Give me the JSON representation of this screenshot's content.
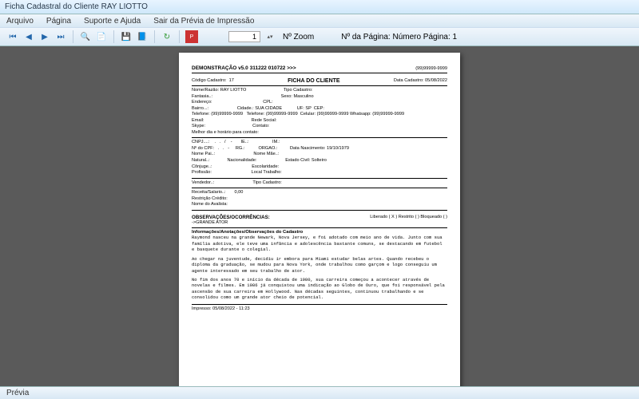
{
  "window": {
    "title": "Ficha Cadastral do Cliente RAY LIOTTO"
  },
  "menu": {
    "arquivo": "Arquivo",
    "pagina": "Página",
    "suporte": "Suporte e Ajuda",
    "sair": "Sair da Prévia de Impressão"
  },
  "toolbar": {
    "zoom_value": "1",
    "zoom_label": "Nº Zoom",
    "pagina_label": "Nº da Página: Número Página: 1"
  },
  "status": {
    "text": "Prévia"
  },
  "doc": {
    "header_title": "DEMONSTRAÇÃO v5.0 311222 010722 >>>",
    "phone": "(99)99999-9999",
    "codigo_label": "Código Cadastro:",
    "codigo": "17",
    "ficha_title": "FICHA DO CLIENTE",
    "data_label": "Data Cadastro: 05/08/2022",
    "nome": "Nome/Razão: RAY LIOTTO                              Tipo Cadastro:",
    "fantasia": "Fantasia..:                                                       Sexo: Masculino",
    "endereco": "Endereço:                                         CPL:",
    "bairro": "Bairro...:                       Cidade.: SUA CIDADE            UF: SP  CEP:",
    "telefone": "Telefone: (99)99999-9999   Telefone: (99)99999-9999  Celular: (99)99999-9999 Whatsapp: (99)99999-9999",
    "email": "Email:                                      Rede Social:",
    "skype": "Skype:                                      Contato:",
    "melhor": "Melhor dia e horário para contato:",
    "cnpj": "CNPJ....:    .   .   /    -       IE..:                   IM.:",
    "cpf": "Nº do CPF:   .   .   -     RG.:           ORGAO.:          Data Nascimento: 19/10/1979",
    "pai": "Nome Pai..:                               Nome Mãe..:",
    "natural": "Natural..:              Nacionalidade:                       Estado Civil: Solteiro",
    "conjuge": "Cônjuge..:                                Escolaridade:",
    "profissao": "Profissão:                                Local Trabalho:",
    "vendedor": "Vendedor..:                               Tipo Cadastro:",
    "receita": "Receita/Salario..:       0,00",
    "restricao": "Restrição Crédito:",
    "avalista": "Nome do Avalista:",
    "obs_title": "OBSERVAÇÕES/OCORRÊNCIAS:",
    "obs_flags": "Liberado ( X )    Restrito (   )    Bloqueado (   )",
    "obs_sub": "->GRANDE ATOR",
    "info_title": "Informações/Anotações/Observações do Cadastro",
    "p1": "Raymond nasceu na grande Newark, Nova Jersey, e foi adotado com meio ano de vida. Junto com sua família adotiva, ele teve uma infância e adolescência bastante comuns, se destacando em futebol e basquete durante o colegial.",
    "p2": "Ao chegar na juventude, decidiu ir embora para Miami estudar belas artes. Quando recebeu o diploma da graduação, se mudou para Nova York, onde trabalhou como garçom e logo conseguiu um agente interessado em seu trabalho de ator.",
    "p3": "No fim dos anos 70 e início da década de 1980, sua carreira começou a acontecer através de novelas e filmes. Em 1986 já conquistou uma indicação ao Globo de Ouro, que foi responsável pela ascensão de sua carreira em Hollywood. Nas décadas seguintes, continuou trabalhando e se consolidou como um grande ator cheio de potencial.",
    "impresso": "Impresso: 05/08/2022 - 11:23"
  }
}
